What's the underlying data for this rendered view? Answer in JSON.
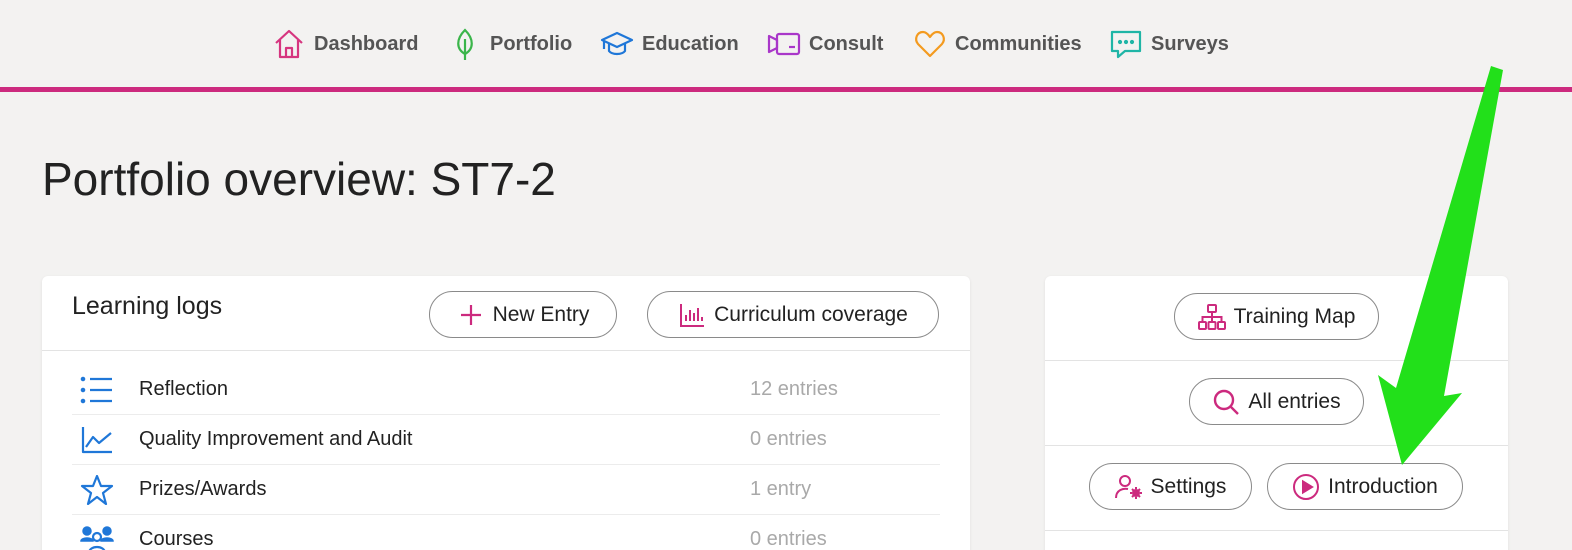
{
  "nav": {
    "items": [
      {
        "label": "Dashboard",
        "icon": "home-icon",
        "color": "#d6357f"
      },
      {
        "label": "Portfolio",
        "icon": "leaf-icon",
        "color": "#3ab54a"
      },
      {
        "label": "Education",
        "icon": "graduation-cap-icon",
        "color": "#1f77d8"
      },
      {
        "label": "Consult",
        "icon": "video-icon",
        "color": "#a937c9"
      },
      {
        "label": "Communities",
        "icon": "heart-icon",
        "color": "#f39a1f"
      },
      {
        "label": "Surveys",
        "icon": "chat-icon",
        "color": "#1fb5a6"
      }
    ],
    "accent": "#cc2a7e"
  },
  "page": {
    "title": "Portfolio overview: ST7-2"
  },
  "learning_logs": {
    "title": "Learning logs",
    "new_entry_label": "New Entry",
    "curriculum_label": "Curriculum coverage",
    "rows": [
      {
        "label": "Reflection",
        "count": "12 entries",
        "icon": "list-icon"
      },
      {
        "label": "Quality Improvement and Audit",
        "count": "0 entries",
        "icon": "line-chart-icon"
      },
      {
        "label": "Prizes/Awards",
        "count": "1 entry",
        "icon": "star-icon"
      },
      {
        "label": "Courses",
        "count": "0 entries",
        "icon": "people-icon"
      }
    ],
    "icon_color": "#1f77d8"
  },
  "side_panel": {
    "training_map_label": "Training Map",
    "all_entries_label": "All entries",
    "settings_label": "Settings",
    "introduction_label": "Introduction",
    "icon_color": "#cc2a7e"
  },
  "annotation": {
    "arrow_color": "#22e01a"
  }
}
